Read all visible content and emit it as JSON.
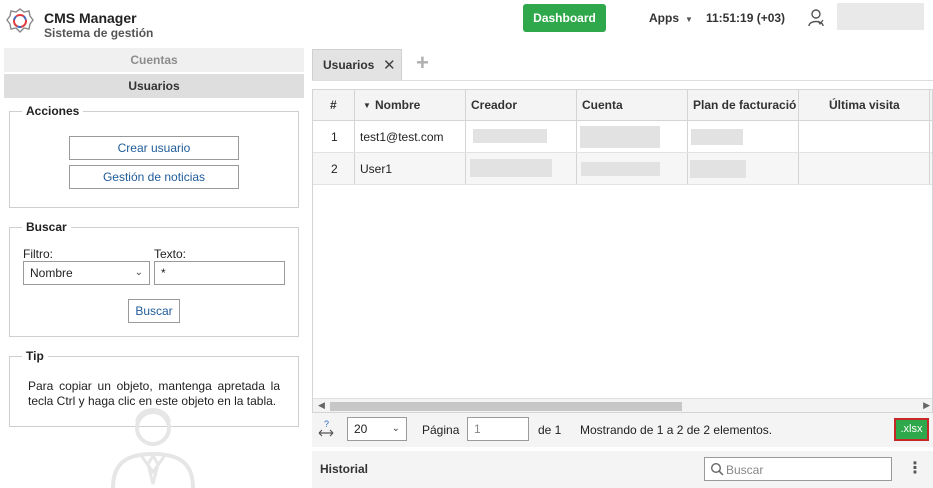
{
  "header": {
    "app_title": "CMS Manager",
    "app_subtitle": "Sistema de gestión",
    "dashboard_label": "Dashboard",
    "apps_label": "Apps",
    "clock": "11:51:19 (+03)",
    "brand_color": "#2ea84a"
  },
  "sidebar": {
    "tabs": [
      {
        "label": "Cuentas",
        "active": false
      },
      {
        "label": "Usuarios",
        "active": true
      }
    ],
    "acciones": {
      "legend": "Acciones",
      "buttons": [
        "Crear usuario",
        "Gestión de noticias"
      ]
    },
    "buscar": {
      "legend": "Buscar",
      "filter_label": "Filtro:",
      "filter_value": "Nombre",
      "text_label": "Texto:",
      "text_value": "*",
      "button": "Buscar"
    },
    "tip": {
      "legend": "Tip",
      "text": "Para copiar un objeto, mantenga apretada la tecla Ctrl y haga clic en este objeto en la tabla."
    }
  },
  "main": {
    "tab_label": "Usuarios",
    "grid": {
      "columns": [
        "#",
        "Nombre",
        "Creador",
        "Cuenta",
        "Plan de facturación",
        "Última visita"
      ],
      "sorted_column": "Nombre",
      "rows": [
        {
          "num": "1",
          "nombre": "test1@test.com"
        },
        {
          "num": "2",
          "nombre": "User1"
        }
      ]
    },
    "pager": {
      "page_size": "20",
      "page_label": "Página",
      "page_value": "1",
      "of_label": "de 1",
      "summary": "Mostrando de 1 a 2 de 2 elementos.",
      "export_label": ".xlsx"
    },
    "historial": {
      "title": "Historial",
      "search_placeholder": "Buscar"
    }
  }
}
